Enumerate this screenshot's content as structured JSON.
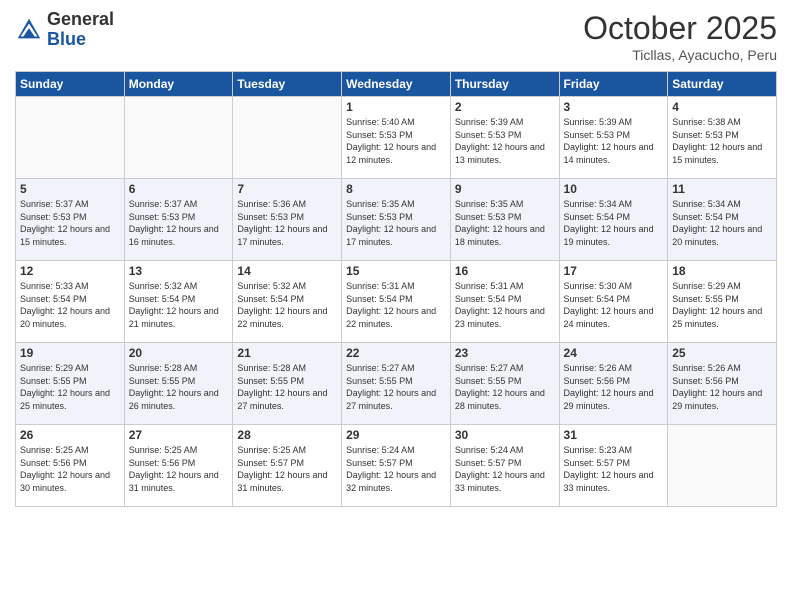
{
  "header": {
    "logo_general": "General",
    "logo_blue": "Blue",
    "month_title": "October 2025",
    "subtitle": "Ticllas, Ayacucho, Peru"
  },
  "weekdays": [
    "Sunday",
    "Monday",
    "Tuesday",
    "Wednesday",
    "Thursday",
    "Friday",
    "Saturday"
  ],
  "weeks": [
    [
      {
        "day": "",
        "info": ""
      },
      {
        "day": "",
        "info": ""
      },
      {
        "day": "",
        "info": ""
      },
      {
        "day": "1",
        "info": "Sunrise: 5:40 AM\nSunset: 5:53 PM\nDaylight: 12 hours and 12 minutes."
      },
      {
        "day": "2",
        "info": "Sunrise: 5:39 AM\nSunset: 5:53 PM\nDaylight: 12 hours and 13 minutes."
      },
      {
        "day": "3",
        "info": "Sunrise: 5:39 AM\nSunset: 5:53 PM\nDaylight: 12 hours and 14 minutes."
      },
      {
        "day": "4",
        "info": "Sunrise: 5:38 AM\nSunset: 5:53 PM\nDaylight: 12 hours and 15 minutes."
      }
    ],
    [
      {
        "day": "5",
        "info": "Sunrise: 5:37 AM\nSunset: 5:53 PM\nDaylight: 12 hours and 15 minutes."
      },
      {
        "day": "6",
        "info": "Sunrise: 5:37 AM\nSunset: 5:53 PM\nDaylight: 12 hours and 16 minutes."
      },
      {
        "day": "7",
        "info": "Sunrise: 5:36 AM\nSunset: 5:53 PM\nDaylight: 12 hours and 17 minutes."
      },
      {
        "day": "8",
        "info": "Sunrise: 5:35 AM\nSunset: 5:53 PM\nDaylight: 12 hours and 17 minutes."
      },
      {
        "day": "9",
        "info": "Sunrise: 5:35 AM\nSunset: 5:53 PM\nDaylight: 12 hours and 18 minutes."
      },
      {
        "day": "10",
        "info": "Sunrise: 5:34 AM\nSunset: 5:54 PM\nDaylight: 12 hours and 19 minutes."
      },
      {
        "day": "11",
        "info": "Sunrise: 5:34 AM\nSunset: 5:54 PM\nDaylight: 12 hours and 20 minutes."
      }
    ],
    [
      {
        "day": "12",
        "info": "Sunrise: 5:33 AM\nSunset: 5:54 PM\nDaylight: 12 hours and 20 minutes."
      },
      {
        "day": "13",
        "info": "Sunrise: 5:32 AM\nSunset: 5:54 PM\nDaylight: 12 hours and 21 minutes."
      },
      {
        "day": "14",
        "info": "Sunrise: 5:32 AM\nSunset: 5:54 PM\nDaylight: 12 hours and 22 minutes."
      },
      {
        "day": "15",
        "info": "Sunrise: 5:31 AM\nSunset: 5:54 PM\nDaylight: 12 hours and 22 minutes."
      },
      {
        "day": "16",
        "info": "Sunrise: 5:31 AM\nSunset: 5:54 PM\nDaylight: 12 hours and 23 minutes."
      },
      {
        "day": "17",
        "info": "Sunrise: 5:30 AM\nSunset: 5:54 PM\nDaylight: 12 hours and 24 minutes."
      },
      {
        "day": "18",
        "info": "Sunrise: 5:29 AM\nSunset: 5:55 PM\nDaylight: 12 hours and 25 minutes."
      }
    ],
    [
      {
        "day": "19",
        "info": "Sunrise: 5:29 AM\nSunset: 5:55 PM\nDaylight: 12 hours and 25 minutes."
      },
      {
        "day": "20",
        "info": "Sunrise: 5:28 AM\nSunset: 5:55 PM\nDaylight: 12 hours and 26 minutes."
      },
      {
        "day": "21",
        "info": "Sunrise: 5:28 AM\nSunset: 5:55 PM\nDaylight: 12 hours and 27 minutes."
      },
      {
        "day": "22",
        "info": "Sunrise: 5:27 AM\nSunset: 5:55 PM\nDaylight: 12 hours and 27 minutes."
      },
      {
        "day": "23",
        "info": "Sunrise: 5:27 AM\nSunset: 5:55 PM\nDaylight: 12 hours and 28 minutes."
      },
      {
        "day": "24",
        "info": "Sunrise: 5:26 AM\nSunset: 5:56 PM\nDaylight: 12 hours and 29 minutes."
      },
      {
        "day": "25",
        "info": "Sunrise: 5:26 AM\nSunset: 5:56 PM\nDaylight: 12 hours and 29 minutes."
      }
    ],
    [
      {
        "day": "26",
        "info": "Sunrise: 5:25 AM\nSunset: 5:56 PM\nDaylight: 12 hours and 30 minutes."
      },
      {
        "day": "27",
        "info": "Sunrise: 5:25 AM\nSunset: 5:56 PM\nDaylight: 12 hours and 31 minutes."
      },
      {
        "day": "28",
        "info": "Sunrise: 5:25 AM\nSunset: 5:57 PM\nDaylight: 12 hours and 31 minutes."
      },
      {
        "day": "29",
        "info": "Sunrise: 5:24 AM\nSunset: 5:57 PM\nDaylight: 12 hours and 32 minutes."
      },
      {
        "day": "30",
        "info": "Sunrise: 5:24 AM\nSunset: 5:57 PM\nDaylight: 12 hours and 33 minutes."
      },
      {
        "day": "31",
        "info": "Sunrise: 5:23 AM\nSunset: 5:57 PM\nDaylight: 12 hours and 33 minutes."
      },
      {
        "day": "",
        "info": ""
      }
    ]
  ]
}
